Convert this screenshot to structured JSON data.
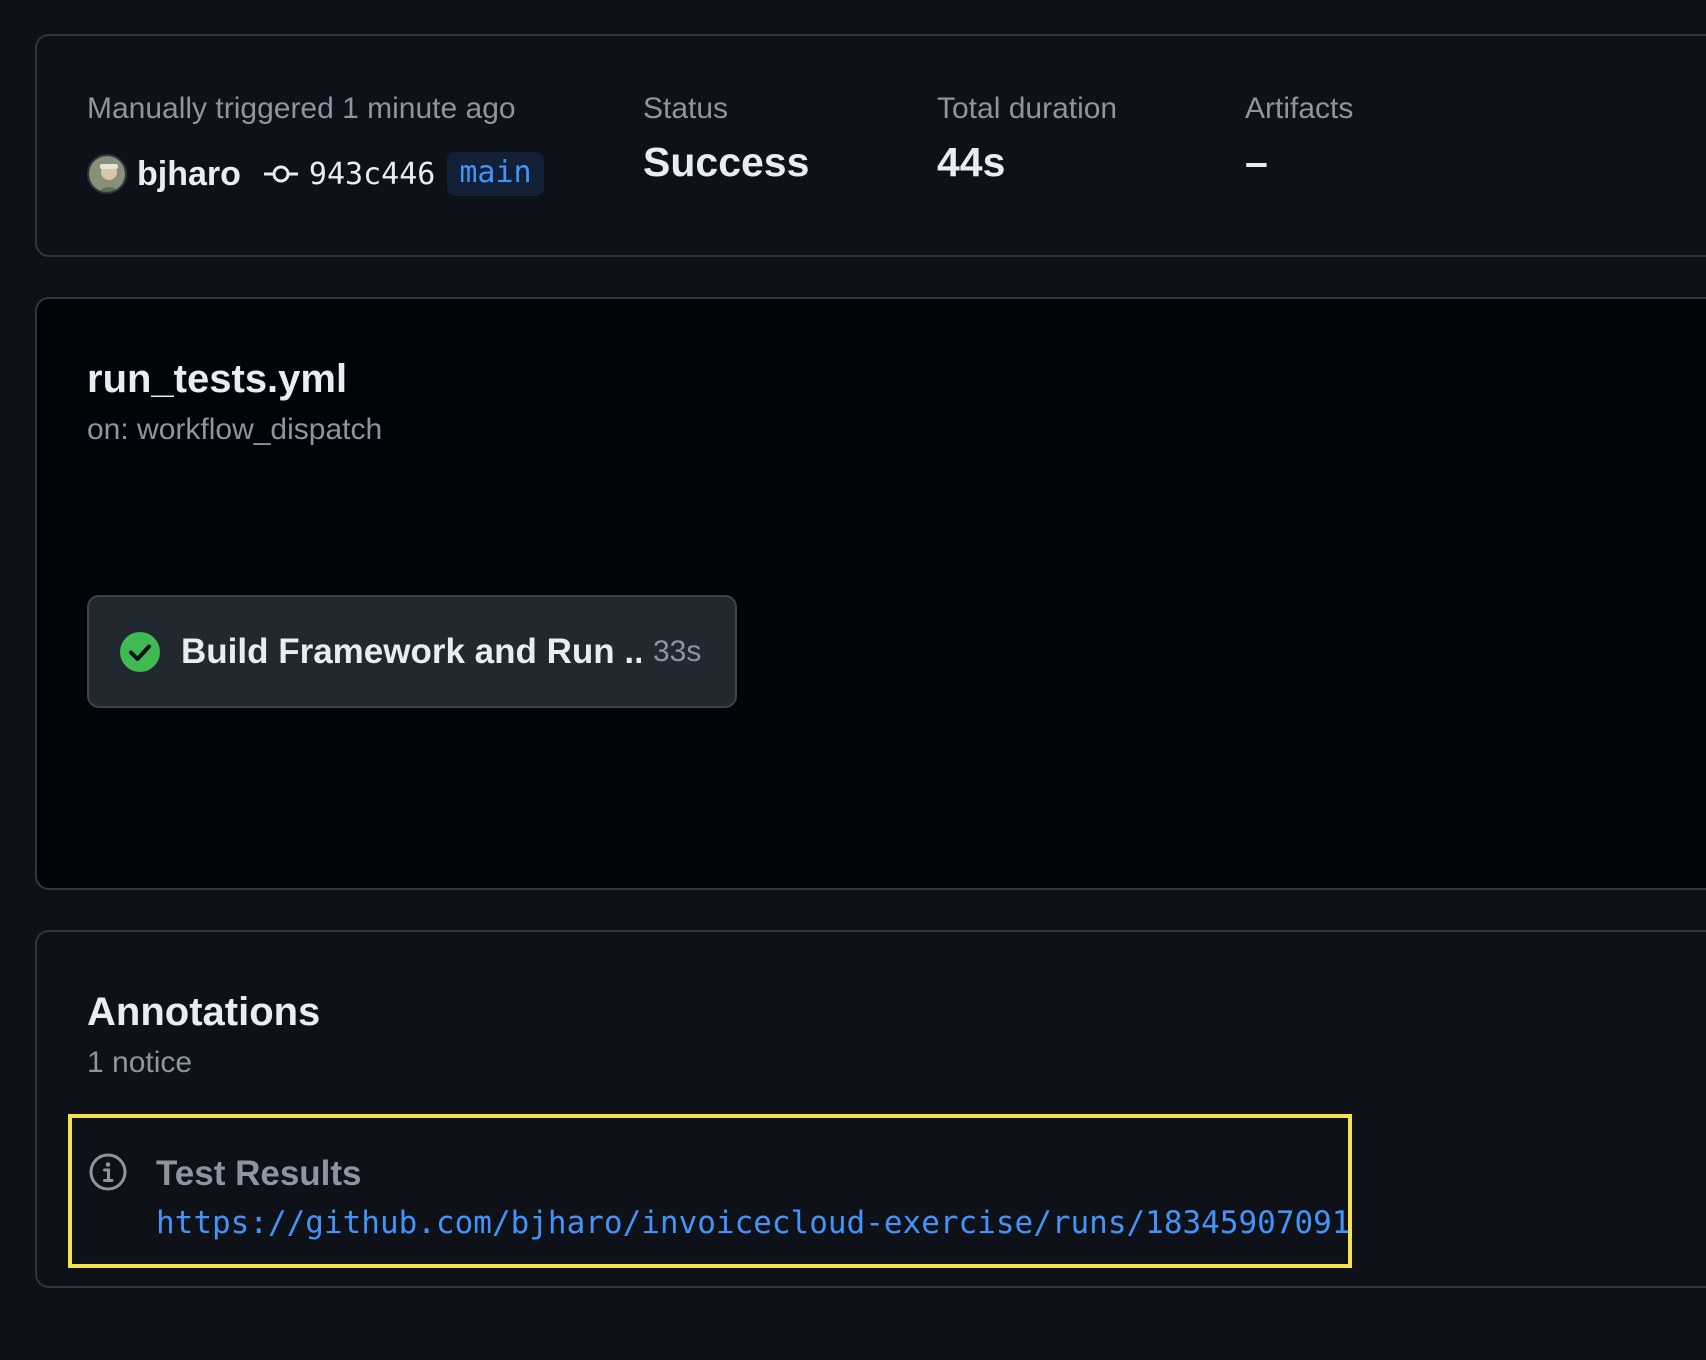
{
  "summary": {
    "trigger_text": "Manually triggered 1 minute ago",
    "actor": "bjharo",
    "commit_sha": "943c446",
    "branch": "main",
    "status_label": "Status",
    "status_value": "Success",
    "duration_label": "Total duration",
    "duration_value": "44s",
    "artifacts_label": "Artifacts",
    "artifacts_value": "–"
  },
  "workflow": {
    "file": "run_tests.yml",
    "trigger": "on: workflow_dispatch",
    "jobs": [
      {
        "name": "Build Framework and Run ...",
        "duration": "33s",
        "status": "success",
        "status_icon": "check-circle-icon"
      }
    ]
  },
  "annotations": {
    "title": "Annotations",
    "count_text": "1 notice",
    "items": [
      {
        "icon": "info-icon",
        "title": "Test Results",
        "link": "https://github.com/bjharo/invoicecloud-exercise/runs/18345907091"
      }
    ]
  },
  "colors": {
    "background": "#0e1117",
    "graph_background": "#010409",
    "border": "#30363d",
    "text_primary": "#e6edf3",
    "text_muted": "#8d96a0",
    "link": "#4493f8",
    "success": "#3fb950",
    "highlight": "#f5e54a"
  }
}
